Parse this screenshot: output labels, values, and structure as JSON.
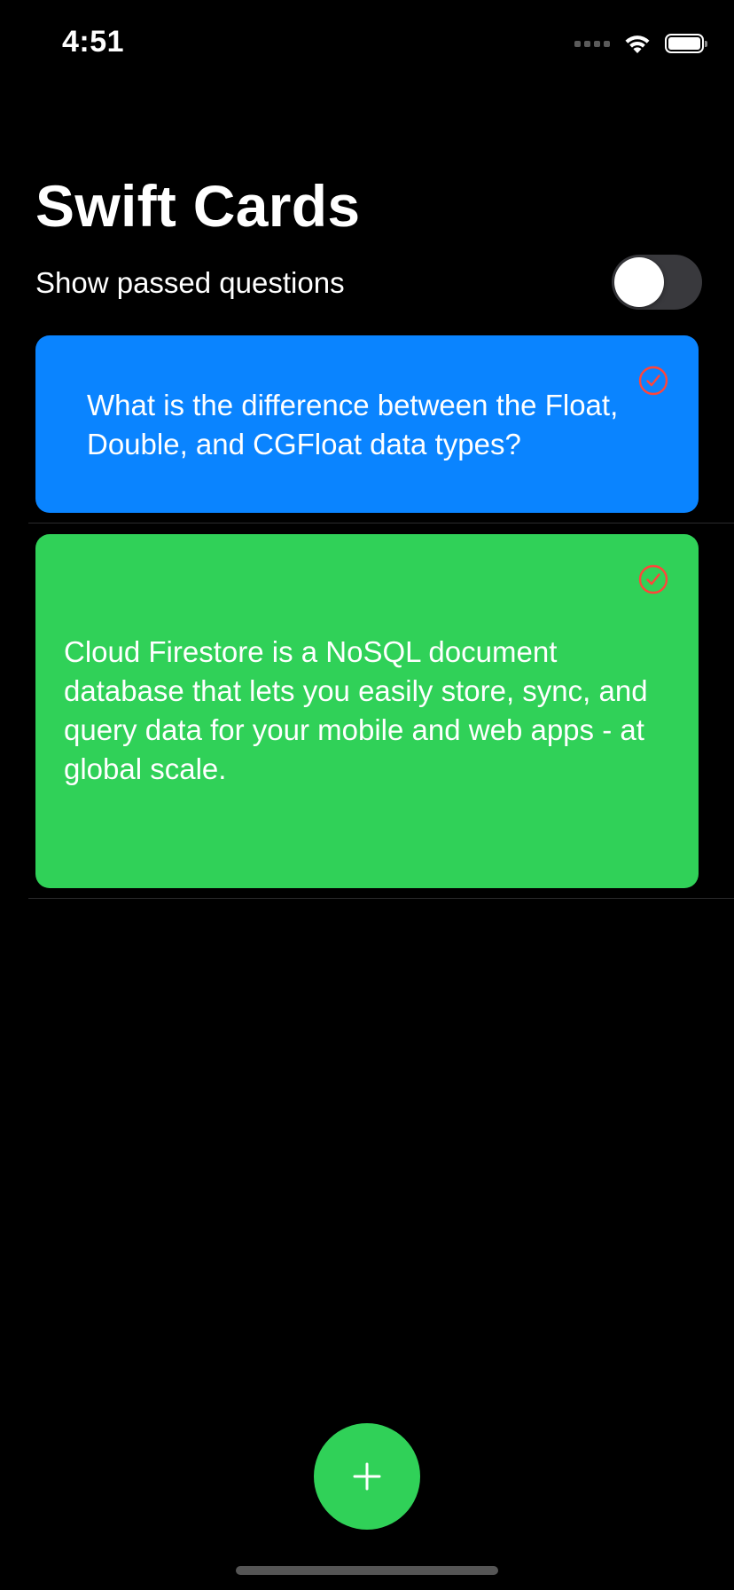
{
  "status_bar": {
    "time": "4:51"
  },
  "header": {
    "title": "Swift Cards"
  },
  "filter": {
    "label": "Show passed questions",
    "enabled": false
  },
  "cards": [
    {
      "text": "What is the difference between the Float, Double, and CGFloat data types?",
      "color": "#0a84ff",
      "icon": "checkmark-circle-icon"
    },
    {
      "text": "Cloud Firestore is a NoSQL document database that lets you easily store, sync, and query data for your mobile and web apps - at global scale.",
      "color": "#30d158",
      "icon": "checkmark-circle-icon"
    }
  ],
  "fab": {
    "icon": "plus-icon",
    "color": "#30d158"
  },
  "colors": {
    "background": "#000000",
    "check_icon": "#ff453a",
    "toggle_off": "#39393d"
  }
}
